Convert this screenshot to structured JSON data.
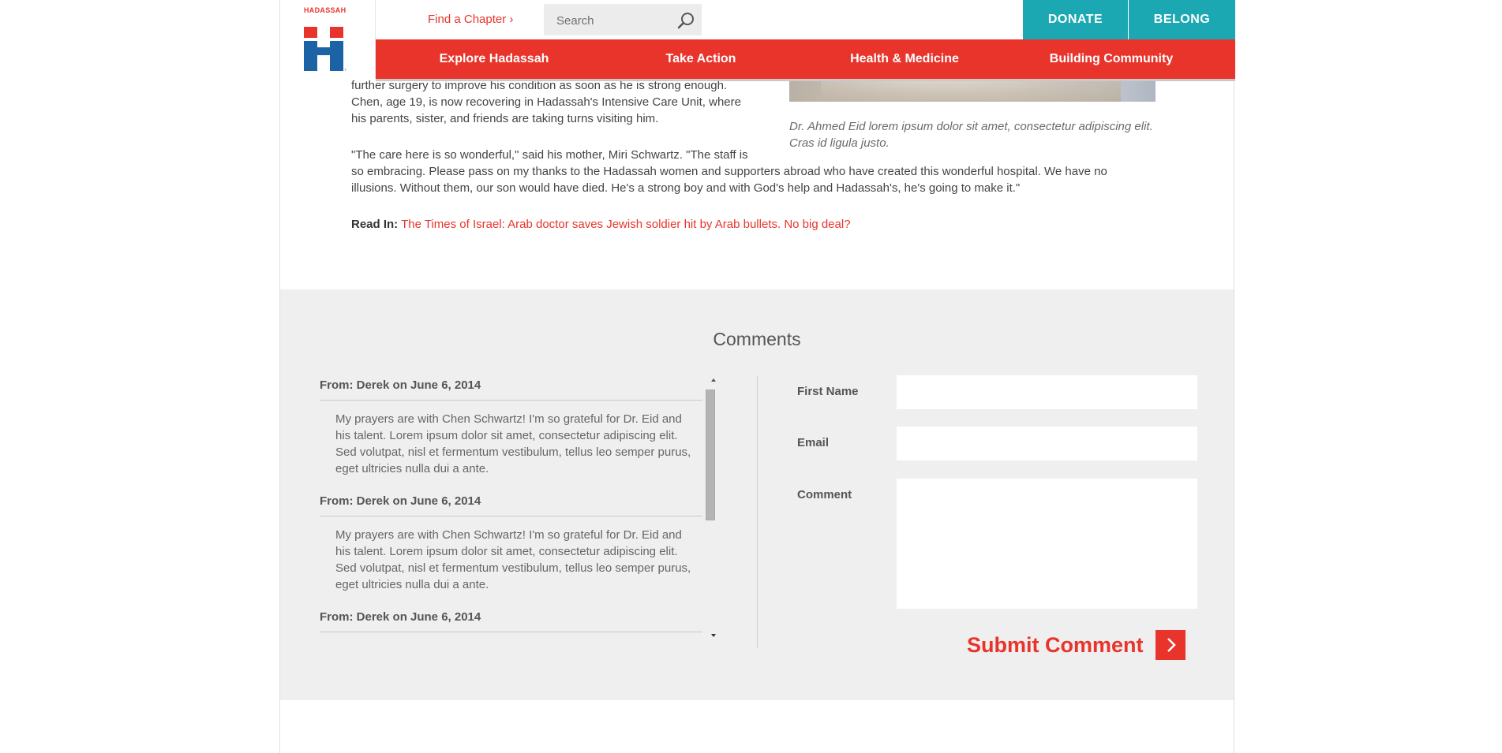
{
  "header": {
    "logo_text": "HADASSAH",
    "find_chapter": "Find a Chapter ›",
    "search_placeholder": "Search",
    "donate": "DONATE",
    "belong": "BELONG",
    "nav": [
      "Explore Hadassah",
      "Take Action",
      "Health & Medicine",
      "Building Community"
    ]
  },
  "article": {
    "p1": "further surgery to improve his condition as soon as he is strong enough. Chen, age 19, is now recovering in Hadassah's Intensive Care Unit, where his parents, sister, and friends are taking turns visiting him.",
    "p2_line1": "\"The care here is so wonderful,\" said his mother, Miri Schwartz. \"The staff is",
    "p2_rest": "so embracing. Please pass on my thanks to the Hadassah women and supporters abroad who have created this wonderful hospital. We have no illusions. Without them, our son would have died. He's a strong boy and with God's help and Hadassah's, he's going to make it.\"",
    "caption": "Dr. Ahmed Eid lorem ipsum dolor sit amet, consectetur adipiscing elit. Cras id ligula justo.",
    "readin_label": "Read In:",
    "readin_link": "The Times of Israel: Arab doctor saves Jewish soldier hit by Arab bullets. No big deal?"
  },
  "comments": {
    "title": "Comments",
    "items": [
      {
        "head": "From: Derek on June 6, 2014",
        "body": "My prayers are with Chen Schwartz! I'm so grateful for Dr. Eid and his talent. Lorem ipsum dolor sit amet, consectetur adipiscing elit. Sed volutpat, nisl et fermentum vestibulum, tellus leo semper purus, eget ultricies nulla dui a ante."
      },
      {
        "head": "From: Derek on June 6, 2014",
        "body": "My prayers are with Chen Schwartz! I'm so grateful for Dr. Eid and his talent. Lorem ipsum dolor sit amet, consectetur adipiscing elit. Sed volutpat, nisl et fermentum vestibulum, tellus leo semper purus, eget ultricies nulla dui a ante."
      },
      {
        "head": "From: Derek on June 6, 2014",
        "body": ""
      }
    ],
    "form": {
      "first_name": "First Name",
      "email": "Email",
      "comment": "Comment",
      "submit": "Submit Comment"
    }
  },
  "colors": {
    "brand_red": "#e8342b",
    "teal": "#1ba8b3",
    "logo_blue": "#1c63a6"
  }
}
